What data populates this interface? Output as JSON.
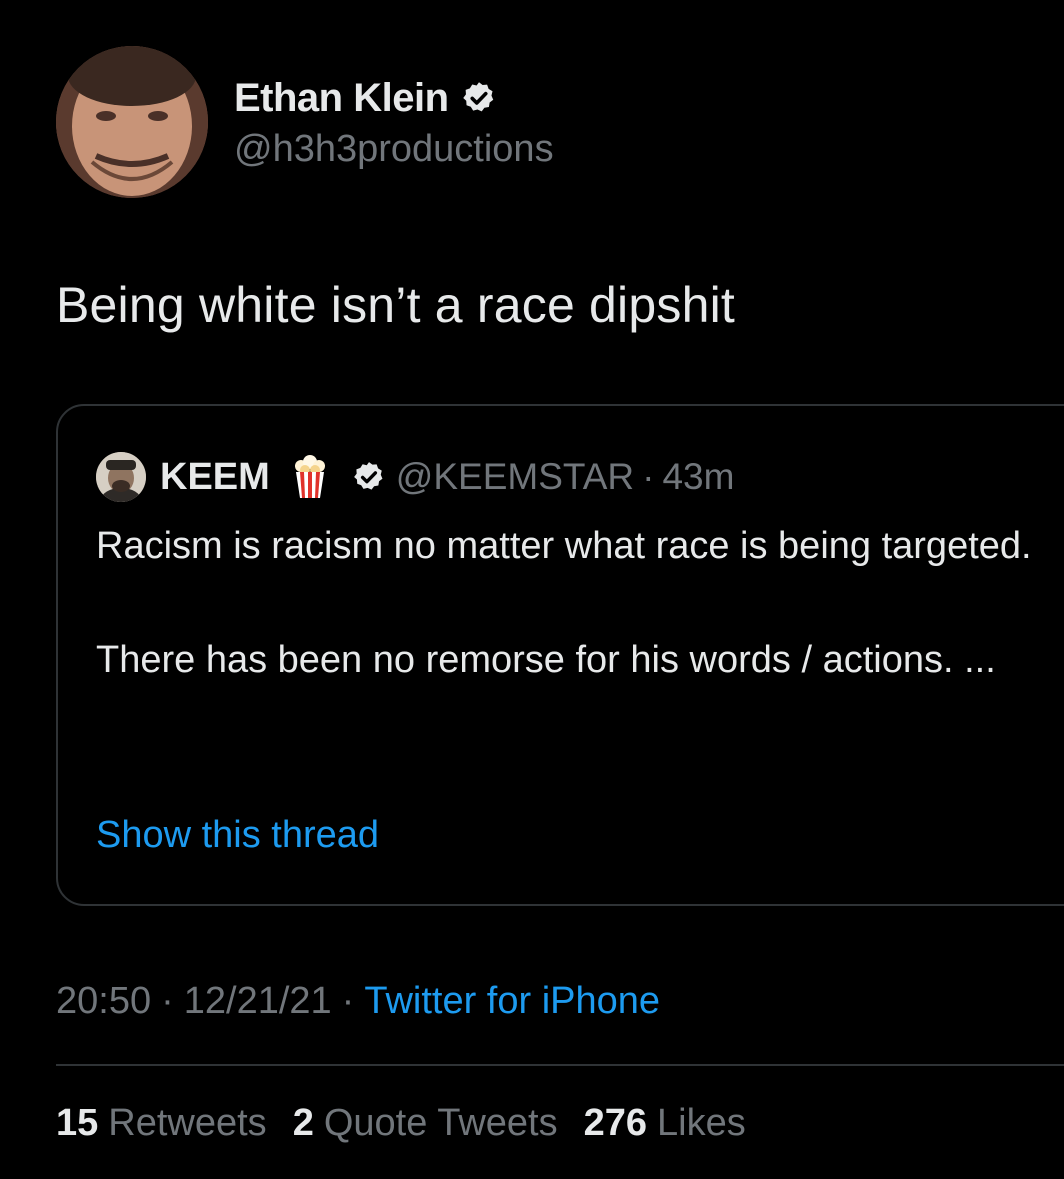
{
  "tweet": {
    "author": {
      "name": "Ethan Klein",
      "handle": "@h3h3productions",
      "verified": true,
      "avatar_icon": "avatar-photo"
    },
    "text": "Being white isn’t a race dipshit",
    "quote": {
      "author": {
        "name": "KEEM",
        "emoji_icon": "popcorn-icon",
        "verified": true,
        "handle": "@KEEMSTAR",
        "separator": "·",
        "time": "43m"
      },
      "body": [
        "Racism is racism no matter what race is being targeted.",
        "There has been no remorse for his words / actions. ..."
      ],
      "show_thread": "Show this thread"
    },
    "meta": {
      "time": "20:50",
      "separator": "·",
      "date": "12/21/21",
      "source": "Twitter for iPhone"
    },
    "stats": {
      "retweets_count": "15",
      "retweets_label": "Retweets",
      "quotes_count": "2",
      "quotes_label": "Quote Tweets",
      "likes_count": "276",
      "likes_label": "Likes"
    }
  },
  "colors": {
    "background": "#000000",
    "text_primary": "#e7e9ea",
    "text_secondary": "#71767b",
    "link": "#1d9bf0",
    "border": "#2f3336",
    "verified_badge": "#e7e9ea"
  }
}
